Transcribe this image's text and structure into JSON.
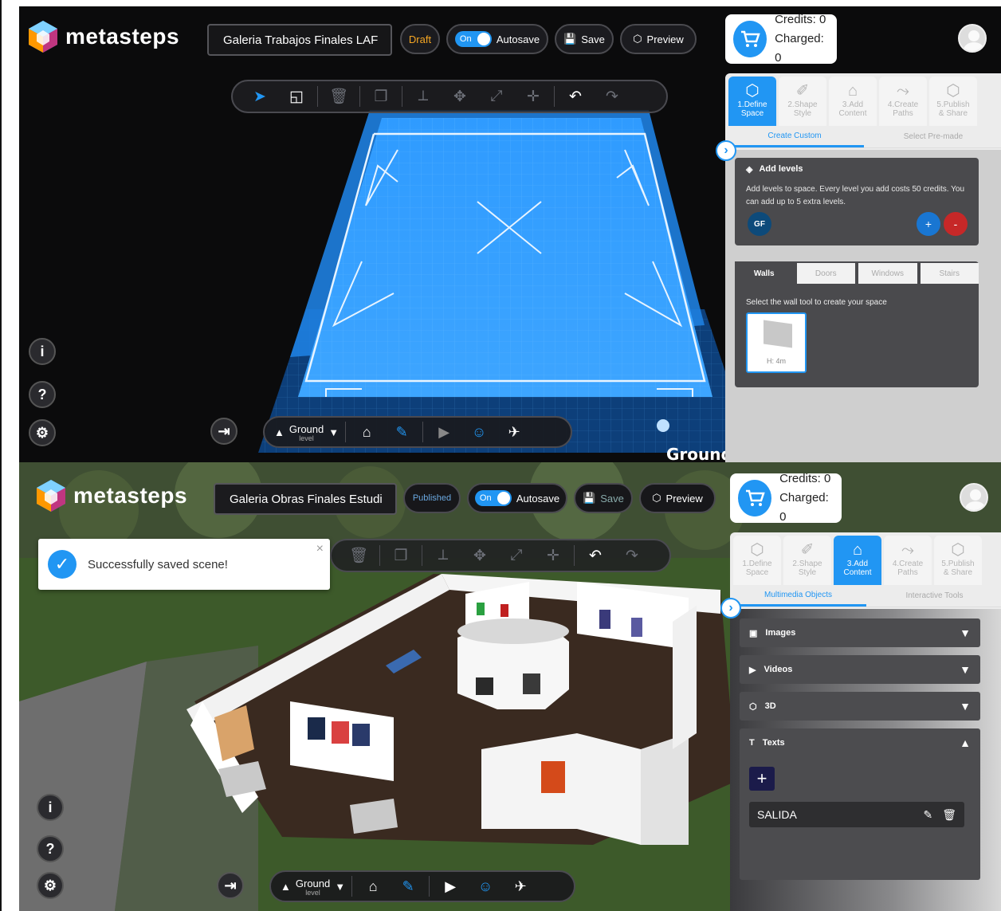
{
  "top": {
    "app_name": "metasteps",
    "scene_title": "Galeria Trabajos Finales LAF",
    "status": "Draft",
    "toggle": "On",
    "autosave": "Autosave",
    "save": "Save",
    "preview": "Preview",
    "credits": "Credits:  0",
    "charged": "Charged: 0",
    "steps": [
      {
        "l1": "1.Define",
        "l2": "Space"
      },
      {
        "l1": "2.Shape",
        "l2": "Style"
      },
      {
        "l1": "3.Add",
        "l2": "Content"
      },
      {
        "l1": "4.Create",
        "l2": "Paths"
      },
      {
        "l1": "5.Publish",
        "l2": "& Share"
      }
    ],
    "subtab_1": "Create Custom",
    "subtab_2": "Select Pre-made",
    "add_levels_title": "Add levels",
    "add_levels_desc": "Add levels to space. Every level you add costs 50 credits. You can add up to 5 extra levels.",
    "level_badge": "GF",
    "plus": "+",
    "minus": "-",
    "wall_tabs": [
      "Walls",
      "Doors",
      "Windows",
      "Stairs"
    ],
    "wall_hint": "Select the wall tool to create your space",
    "wall_height": "H: 4m",
    "level_name": "Ground",
    "level_sub": "level",
    "ground_level_label": "Ground Level"
  },
  "bottom": {
    "app_name": "metasteps",
    "scene_title": "Galeria Obras Finales Estudi",
    "status": "Published",
    "toggle": "On",
    "autosave": "Autosave",
    "save": "Save",
    "preview": "Preview",
    "credits": "Credits:  0",
    "charged": "Charged: 0",
    "toast": "Successfully saved scene!",
    "toast_close": "×",
    "subtab_1": "Multimedia Objects",
    "subtab_2": "Interactive Tools",
    "accordions": [
      "Images",
      "Videos",
      "3D",
      "Texts"
    ],
    "text_item": "SALIDA",
    "level_name": "Ground",
    "level_sub": "level",
    "door_sign": "SALIDA"
  },
  "colors": {
    "accent": "#2196f3",
    "grid_blue": "#1e88e5",
    "panel_dark": "#4a4a4d"
  }
}
